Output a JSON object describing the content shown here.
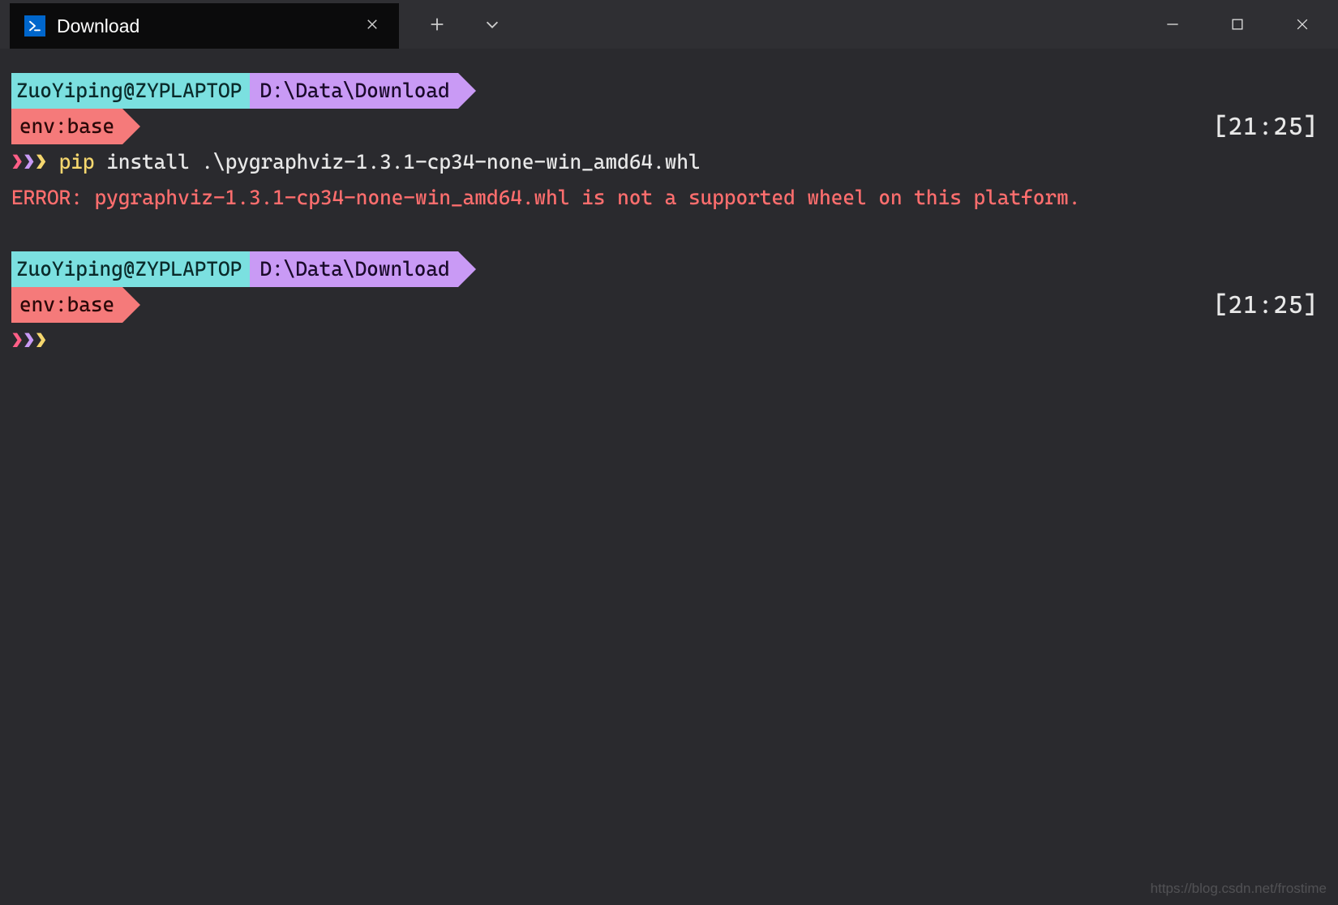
{
  "titlebar": {
    "tab_title": "Download"
  },
  "blocks": [
    {
      "user_host": "ZuoYiping@ZYPLAPTOP",
      "path": "D:\\Data\\Download",
      "env": "env:base",
      "time": "[21:25]",
      "prompt": "❯❯❯",
      "command_first": " pip",
      "command_rest": " install .\\pygraphviz-1.3.1-cp34-none-win_amd64.whl",
      "output_error": "ERROR: pygraphviz-1.3.1-cp34-none-win_amd64.whl is not a supported wheel on this platform."
    },
    {
      "user_host": "ZuoYiping@ZYPLAPTOP",
      "path": "D:\\Data\\Download",
      "env": "env:base",
      "time": "[21:25]",
      "prompt": "❯❯❯",
      "command_first": "",
      "command_rest": "",
      "output_error": ""
    }
  ],
  "watermark": "https://blog.csdn.net/frostime"
}
